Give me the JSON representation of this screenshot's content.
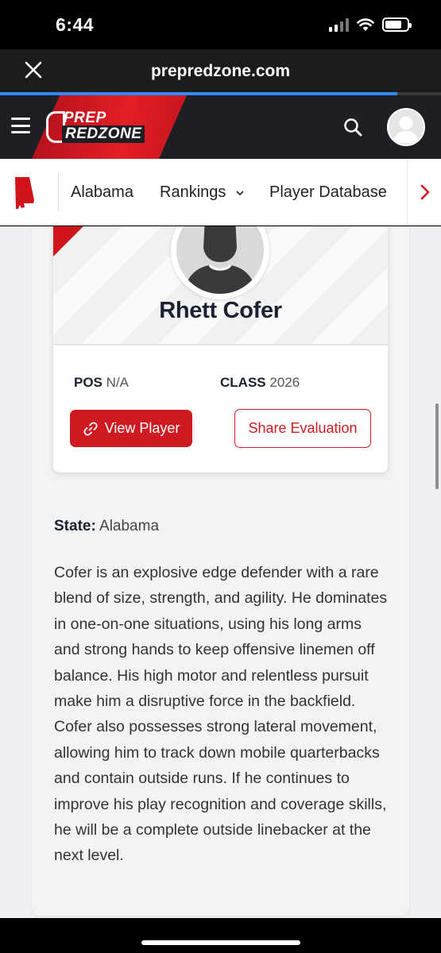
{
  "status_bar": {
    "time": "6:44"
  },
  "browser": {
    "url": "prepredzone.com",
    "load_progress": 0.9
  },
  "site": {
    "logo_line1": "PREP",
    "logo_line2": "REDZONE"
  },
  "state_nav": {
    "items": [
      {
        "label": "Alabama"
      },
      {
        "label": "Rankings"
      },
      {
        "label": "Player Database"
      }
    ]
  },
  "player": {
    "name": "Rhett Cofer",
    "pos_label": "POS",
    "pos_value": "N/A",
    "class_label": "CLASS",
    "class_value": "2026",
    "view_button": "View Player",
    "share_button": "Share Evaluation"
  },
  "evaluation": {
    "state_label": "State:",
    "state_value": "Alabama",
    "text": "Cofer is an explosive edge defender with a rare blend of size, strength, and agility. He dominates in one-on-one situations, using his long arms and strong hands to keep offensive linemen off balance. His high motor and relentless pursuit make him a disruptive force in the backfield. Cofer also possesses strong lateral movement, allowing him to track down mobile quarterbacks and contain outside runs. If he continues to improve his play recognition and coverage skills, he will be a complete outside linebacker at the next level."
  },
  "colors": {
    "brand_red": "#cf1a22",
    "header_dark": "#1d1f25",
    "progress_blue": "#2f8cff"
  },
  "icons": [
    "close-icon",
    "menu-icon",
    "search-icon",
    "user-avatar-icon",
    "alabama-state-icon",
    "chevron-down-icon",
    "chevron-right-icon",
    "link-icon"
  ]
}
